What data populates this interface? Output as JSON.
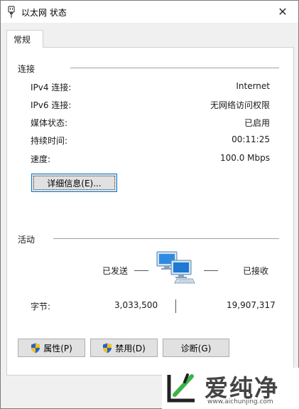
{
  "window": {
    "title": "以太网 状态",
    "close_glyph": "✕"
  },
  "tabs": [
    {
      "label": "常规"
    }
  ],
  "connection": {
    "section_label": "连接",
    "rows": [
      {
        "label": "IPv4 连接:",
        "value": "Internet"
      },
      {
        "label": "IPv6 连接:",
        "value": "无网络访问权限"
      },
      {
        "label": "媒体状态:",
        "value": "已启用"
      },
      {
        "label": "持续时间:",
        "value": "00:11:25"
      },
      {
        "label": "速度:",
        "value": "100.0 Mbps"
      }
    ],
    "details_button": "详细信息(E)..."
  },
  "activity": {
    "section_label": "活动",
    "sent_label": "已发送",
    "received_label": "已接收",
    "bytes_label": "字节:",
    "bytes_sent": "3,033,500",
    "bytes_received": "19,907,317"
  },
  "buttons": {
    "properties": "属性(P)",
    "disable": "禁用(D)",
    "diagnose": "诊断(G)"
  },
  "watermark": {
    "brand": "爱纯净",
    "url": "www.aichunjing.com"
  },
  "colors": {
    "accent": "#0078d7",
    "shield_blue": "#2b62b8",
    "shield_yellow": "#f2c029",
    "logo_green": "#3cb34a"
  }
}
